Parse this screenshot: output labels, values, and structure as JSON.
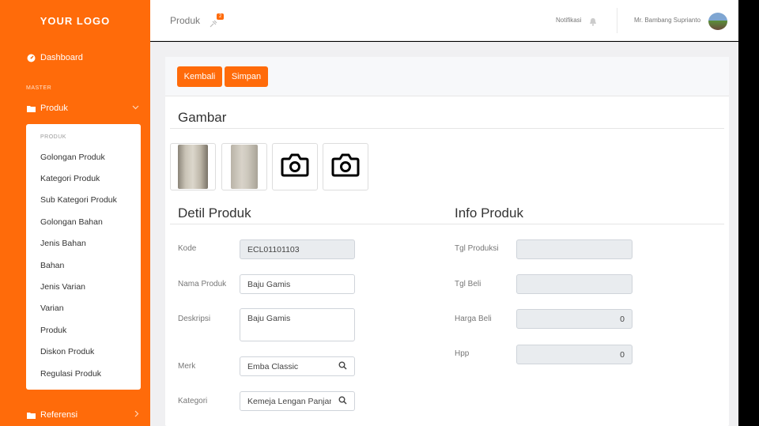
{
  "sidebar": {
    "logo": "YOUR LOGO",
    "dashboard": "Dashboard",
    "section_label": "MASTER",
    "produk": "Produk",
    "submenu_header": "PRODUK",
    "submenu": [
      "Golongan Produk",
      "Kategori Produk",
      "Sub Kategori Produk",
      "Golongan Bahan",
      "Jenis Bahan",
      "Bahan",
      "Jenis Varian",
      "Varian",
      "Produk",
      "Diskon Produk",
      "Regulasi Produk"
    ],
    "referensi": "Referensi",
    "accent": "#ff6b0a"
  },
  "topbar": {
    "breadcrumb": "Produk",
    "badge_count": "2",
    "notifications_label": "Notifikasi",
    "user_name": "Mr. Bambang Suprianto"
  },
  "toolbar": {
    "back_label": "Kembali",
    "save_label": "Simpan"
  },
  "gallery": {
    "title": "Gambar",
    "images": [
      "pants-photo",
      "pants-photo",
      "camera-icon",
      "camera-icon"
    ]
  },
  "detail": {
    "title": "Detil Produk",
    "kode_label": "Kode",
    "kode_value": "ECL01101103",
    "nama_label": "Nama Produk",
    "nama_value": "Baju Gamis",
    "deskripsi_label": "Deskripsi",
    "deskripsi_value": "Baju Gamis",
    "merk_label": "Merk",
    "merk_value": "Emba Classic",
    "kategori_label": "Kategori",
    "kategori_value": "Kemeja Lengan Panjang"
  },
  "info": {
    "title": "Info Produk",
    "tgl_produksi_label": "Tgl Produksi",
    "tgl_produksi_value": "",
    "tgl_beli_label": "Tgl Beli",
    "tgl_beli_value": "",
    "harga_beli_label": "Harga Beli",
    "harga_beli_value": "0",
    "hpp_label": "Hpp",
    "hpp_value": "0"
  }
}
